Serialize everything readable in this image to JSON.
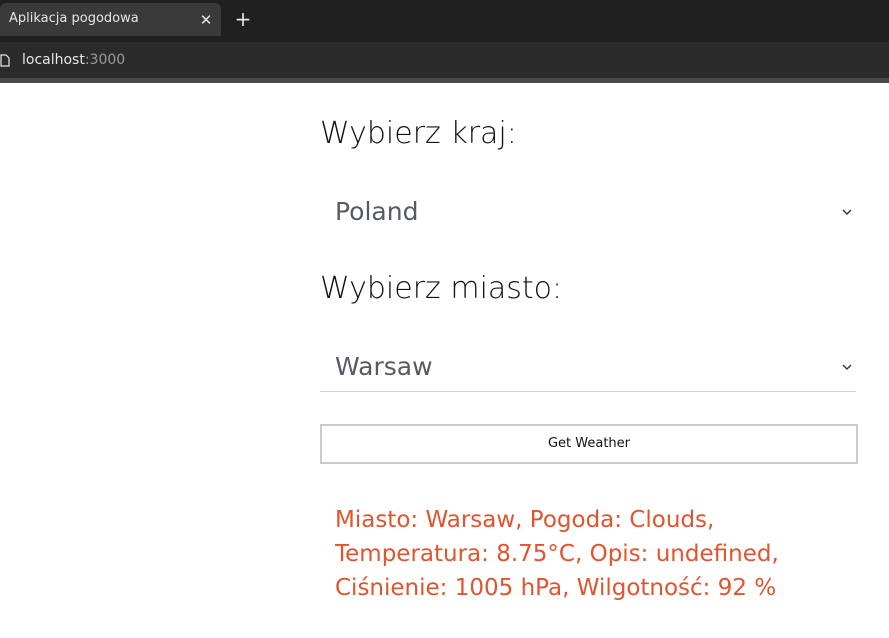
{
  "browser": {
    "tab_title": "Aplikacja pogodowa",
    "tab_close": "✕",
    "new_tab": "+",
    "url_host": "localhost",
    "url_port": ":3000"
  },
  "form": {
    "country_label": "Wybierz kraj:",
    "country_value": "Poland",
    "city_label": "Wybierz miasto:",
    "city_value": "Warsaw",
    "button_label": "Get Weather"
  },
  "result": {
    "text": "Miasto: Warsaw, Pogoda: Clouds, Temperatura: 8.75°C, Opis: undefined, Ciśnienie: 1005 hPa, Wilgotność: 92 %"
  },
  "colors": {
    "result_text": "#e0542e",
    "chrome_dark": "#202020"
  }
}
